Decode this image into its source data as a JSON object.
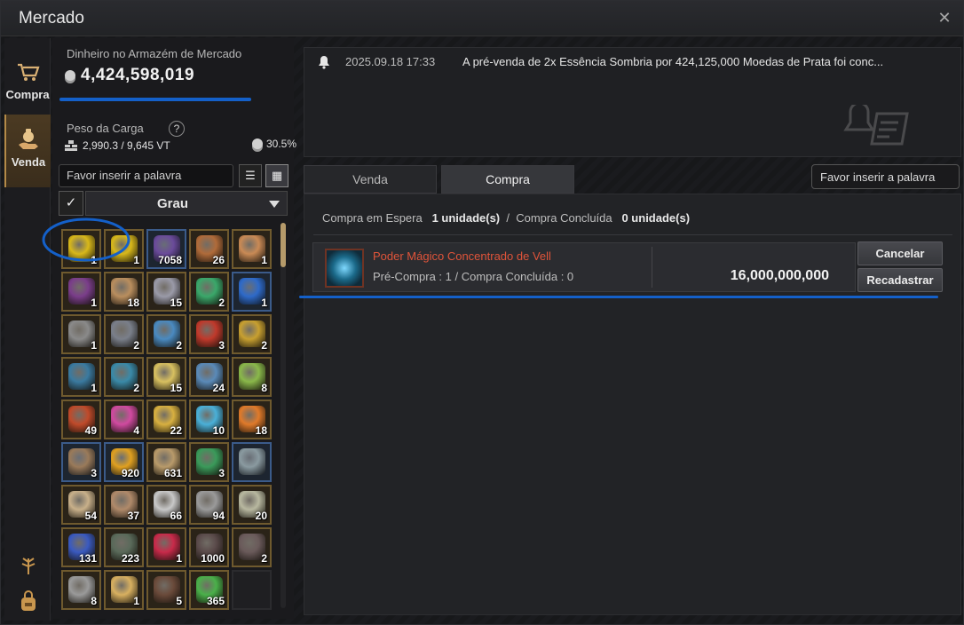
{
  "window": {
    "title": "Mercado",
    "close_symbol": "✕"
  },
  "nav": {
    "items": [
      {
        "label": "Compra",
        "icon": "cart-icon"
      },
      {
        "label": "Venda",
        "icon": "moneybag-hand-icon",
        "active": true
      }
    ]
  },
  "warehouse": {
    "money_label": "Dinheiro no Armazém de Mercado",
    "money_value": "4,424,598,019",
    "weight_label": "Peso da Carga",
    "help_symbol": "?",
    "weight_value": "2,990.3 / 9,645 VT",
    "weight_percent": "30.5%"
  },
  "inventory": {
    "search_placeholder": "Favor inserir a palavra",
    "grade_label": "Grau",
    "checkbox_symbol": "✓",
    "slots": [
      {
        "count": "1",
        "color": "#d8b81a",
        "kind": "gold-crystal"
      },
      {
        "count": "1",
        "color": "#d8b81a",
        "kind": "gold-crystal"
      },
      {
        "count": "7058",
        "color": "#6a4a9a",
        "kind": "purple-shard",
        "blue": true
      },
      {
        "count": "26",
        "color": "#b06b3a",
        "kind": "food"
      },
      {
        "count": "1",
        "color": "#c98a55",
        "kind": "horn"
      },
      {
        "count": "1",
        "color": "#7a3d8a",
        "kind": "dagger"
      },
      {
        "count": "18",
        "color": "#b98e5e",
        "kind": "horn"
      },
      {
        "count": "15",
        "color": "#9a9aa8",
        "kind": "ring"
      },
      {
        "count": "2",
        "color": "#3aa86a",
        "kind": "ring"
      },
      {
        "count": "1",
        "color": "#2e6ac9",
        "kind": "necklace",
        "blue": true
      },
      {
        "count": "1",
        "color": "#8a8a8a",
        "kind": "belt"
      },
      {
        "count": "2",
        "color": "#7a7f8a",
        "kind": "scroll"
      },
      {
        "count": "2",
        "color": "#4a8ac0",
        "kind": "scroll"
      },
      {
        "count": "3",
        "color": "#c0392b",
        "kind": "claw"
      },
      {
        "count": "2",
        "color": "#c8a030",
        "kind": "necklace"
      },
      {
        "count": "1",
        "color": "#3a7aa0",
        "kind": "belt"
      },
      {
        "count": "2",
        "color": "#3a8aa8",
        "kind": "amulet"
      },
      {
        "count": "15",
        "color": "#d8c060",
        "kind": "sparkle"
      },
      {
        "count": "24",
        "color": "#5a8ab8",
        "kind": "feather"
      },
      {
        "count": "8",
        "color": "#8ab84a",
        "kind": "potion"
      },
      {
        "count": "49",
        "color": "#c04a2a",
        "kind": "potion"
      },
      {
        "count": "4",
        "color": "#d04aa0",
        "kind": "potion"
      },
      {
        "count": "22",
        "color": "#d8b040",
        "kind": "crystal-pair"
      },
      {
        "count": "10",
        "color": "#4ab0d8",
        "kind": "potion"
      },
      {
        "count": "18",
        "color": "#e07a2a",
        "kind": "carrot"
      },
      {
        "count": "3",
        "color": "#9a7a5a",
        "kind": "ore",
        "blue": true
      },
      {
        "count": "920",
        "color": "#e0a020",
        "kind": "gem",
        "blue": true
      },
      {
        "count": "631",
        "color": "#b89a6a",
        "kind": "potato"
      },
      {
        "count": "3",
        "color": "#3a9a5a",
        "kind": "herb"
      },
      {
        "count": "",
        "color": "#8a9aa0",
        "kind": "house",
        "blue": true
      },
      {
        "count": "54",
        "color": "#c8b08a",
        "kind": "log"
      },
      {
        "count": "37",
        "color": "#b08a6a",
        "kind": "log"
      },
      {
        "count": "66",
        "color": "#c8c8c8",
        "kind": "log"
      },
      {
        "count": "94",
        "color": "#9a9a9a",
        "kind": "log"
      },
      {
        "count": "20",
        "color": "#b8b8a0",
        "kind": "log"
      },
      {
        "count": "131",
        "color": "#3a5ac0",
        "kind": "potion-flask"
      },
      {
        "count": "223",
        "color": "#5a6a5a",
        "kind": "cone"
      },
      {
        "count": "1",
        "color": "#c82a4a",
        "kind": "red-gem"
      },
      {
        "count": "1000",
        "color": "#5a4a4a",
        "kind": "dark-shard"
      },
      {
        "count": "2",
        "color": "#6a5a5a",
        "kind": "stone"
      },
      {
        "count": "8",
        "color": "#9a9a9a",
        "kind": "vial"
      },
      {
        "count": "1",
        "color": "#d8b060",
        "kind": "gold-ore"
      },
      {
        "count": "5",
        "color": "#6a4a3a",
        "kind": "nuts"
      },
      {
        "count": "365",
        "color": "#4ab04a",
        "kind": "green-crystal"
      },
      {
        "count": "",
        "color": "",
        "kind": "empty",
        "empty": true
      }
    ]
  },
  "notice": {
    "date": "2025.09.18 17:33",
    "message": "A pré-venda de 2x Essência Sombria por 424,125,000 Moedas de Prata foi conc..."
  },
  "tabs": [
    {
      "label": "Venda",
      "active": false
    },
    {
      "label": "Compra",
      "active": true
    }
  ],
  "right_search_placeholder": "Favor inserir a palavra",
  "summary": {
    "waiting_label": "Compra em Espera",
    "waiting_value": "1 unidade(s)",
    "separator": "/",
    "done_label": "Compra Concluída",
    "done_value": "0 unidade(s)"
  },
  "order": {
    "name": "Poder Mágico Concentrado de Vell",
    "sub": "Pré-Compra : 1 / Compra Concluída : 0",
    "price": "16,000,000,000",
    "cancel_label": "Cancelar",
    "relist_label": "Recadastrar"
  },
  "colors": {
    "accent_gold": "#b48a48",
    "highlight_blue": "#1460c9",
    "item_name_red": "#e0543a"
  }
}
